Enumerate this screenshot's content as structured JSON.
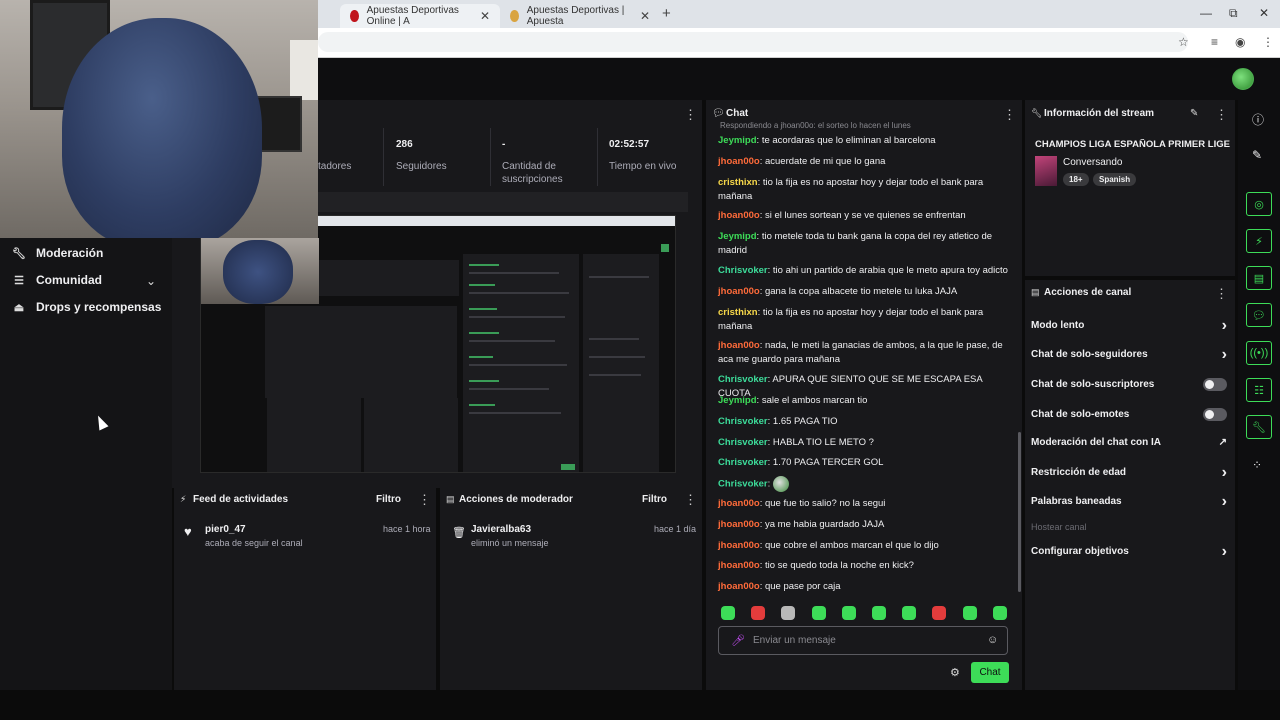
{
  "browser": {
    "tabs": [
      {
        "label": "Apuestas Deportivas Online | A"
      },
      {
        "label": "Apuestas Deportivas | Apuesta"
      }
    ],
    "new_tab": "+",
    "window_controls": {
      "minimize": "—",
      "restore": "⧉",
      "close": "✕"
    }
  },
  "sidebar": {
    "items": [
      {
        "label": "Moderación",
        "icon": "wrench-icon"
      },
      {
        "label": "Comunidad",
        "icon": "community-icon"
      },
      {
        "label": "Drops y recompensas",
        "icon": "drops-icon"
      }
    ]
  },
  "stats": {
    "items": [
      {
        "value": "",
        "label": "tadores"
      },
      {
        "value": "286",
        "label": "Seguidores"
      },
      {
        "value": "-",
        "label": "Cantidad de suscripciones"
      },
      {
        "value": "02:52:57",
        "label": "Tiempo en vivo"
      }
    ]
  },
  "activity_feed": {
    "title": "Feed de actividades",
    "filter": "Filtro",
    "items": [
      {
        "name": "pier0_47",
        "action": "acaba de seguir el canal",
        "time": "hace 1 hora"
      }
    ]
  },
  "mod_actions": {
    "title": "Acciones de moderador",
    "filter": "Filtro",
    "items": [
      {
        "name": "Javieralba63",
        "action": "eliminó un mensaje",
        "time": "hace 1 día"
      }
    ]
  },
  "chat": {
    "title": "Chat",
    "reply_hint": "Respondiendo a jhoan00o: el sorteo lo hacen el lunes",
    "messages": [
      {
        "user": "Jeymipd",
        "color": "#3ddc58",
        "text": "te acordaras que lo eliminan al barcelona"
      },
      {
        "user": "jhoan00o",
        "color": "#ff6b3a",
        "text": "acuerdate de mi que lo gana"
      },
      {
        "user": "cristhixn",
        "color": "#f7d84a",
        "text": "tio la fija es no apostar hoy y dejar todo el bank para mañana"
      },
      {
        "user": "jhoan00o",
        "color": "#ff6b3a",
        "text": "si el lunes sortean y se ve quienes se enfrentan"
      },
      {
        "user": "Jeymipd",
        "color": "#3ddc58",
        "text": "tio metele toda tu bank gana la copa del rey atletico de madrid"
      },
      {
        "user": "Chrisvoker",
        "color": "#3ddc9a",
        "text": "tio ahi un partido de arabia que le meto apura toy adicto"
      },
      {
        "user": "jhoan00o",
        "color": "#ff6b3a",
        "text": "gana la copa albacete tio metele tu luka JAJA"
      },
      {
        "user": "cristhixn",
        "color": "#f7d84a",
        "text": "tio la fija es no apostar hoy y dejar todo el bank para mañana"
      },
      {
        "user": "jhoan00o",
        "color": "#ff6b3a",
        "text": "nada, le meti la ganacias de ambos, a la que le pase, de aca me guardo para mañana"
      },
      {
        "user": "Chrisvoker",
        "color": "#3ddc9a",
        "text": "APURA QUE SIENTO QUE SE ME ESCAPA ESA CUOTA"
      },
      {
        "user": "Jeymipd",
        "color": "#3ddc58",
        "text": "sale el ambos marcan tio"
      },
      {
        "user": "Chrisvoker",
        "color": "#3ddc9a",
        "text": "1.65 PAGA TIO"
      },
      {
        "user": "Chrisvoker",
        "color": "#3ddc9a",
        "text": "HABLA TIO LE METO ?"
      },
      {
        "user": "Chrisvoker",
        "color": "#3ddc9a",
        "text": "1.70 PAGA TERCER GOL"
      },
      {
        "user": "Chrisvoker",
        "color": "#3ddc9a",
        "text": ""
      },
      {
        "user": "jhoan00o",
        "color": "#ff6b3a",
        "text": "que fue tio salio? no la segui"
      },
      {
        "user": "jhoan00o",
        "color": "#ff6b3a",
        "text": "ya me habia guardado JAJA"
      },
      {
        "user": "jhoan00o",
        "color": "#ff6b3a",
        "text": "que cobre el ambos marcan el que lo dijo"
      },
      {
        "user": "jhoan00o",
        "color": "#ff6b3a",
        "text": "tio se quedo toda la noche en kick?"
      },
      {
        "user": "jhoan00o",
        "color": "#ff6b3a",
        "text": "que pase por caja"
      }
    ],
    "input_placeholder": "Enviar un mensaje",
    "send_label": "Chat",
    "emote_colors": [
      "#3ddc58",
      "#e33c3c",
      "#b8b8b8",
      "#3ddc58",
      "#3ddc58",
      "#3ddc58",
      "#3ddc58",
      "#e33c3c",
      "#3ddc58",
      "#3ddc58"
    ]
  },
  "stream_info": {
    "title": "Información del stream",
    "stream_title": "CHAMPIOS LIGA ESPAÑOLA PRIMER LIGE",
    "category": "Conversando",
    "tags": [
      "18+",
      "Spanish"
    ]
  },
  "channel_actions": {
    "title": "Acciones de canal",
    "items": [
      {
        "label": "Modo lento",
        "control": "chevron"
      },
      {
        "label": "Chat de solo-seguidores",
        "control": "chevron"
      },
      {
        "label": "Chat de solo-suscriptores",
        "control": "toggle"
      },
      {
        "label": "Chat de solo-emotes",
        "control": "toggle"
      },
      {
        "label": "Moderación del chat con IA",
        "control": "external"
      },
      {
        "label": "Restricción de edad",
        "control": "chevron"
      },
      {
        "label": "Palabras baneadas",
        "control": "chevron"
      },
      {
        "label": "Hostear canal",
        "control": "none",
        "disabled": true
      },
      {
        "label": "Configurar objetivos",
        "control": "chevron"
      }
    ]
  },
  "accent_color": "#3ddc58"
}
